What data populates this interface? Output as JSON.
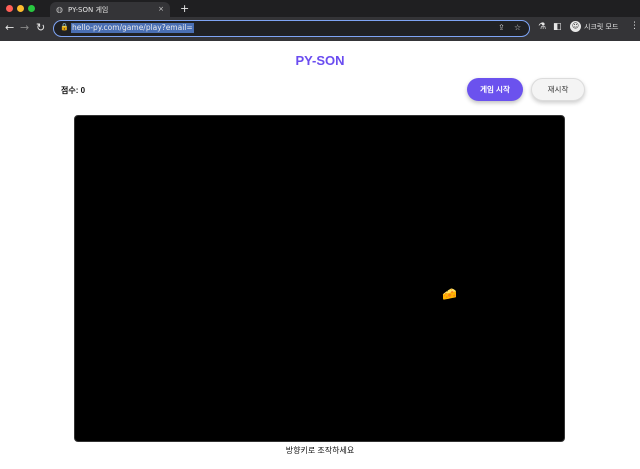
{
  "browser": {
    "tab_title": "PY-SON 게임",
    "tab_close": "×",
    "new_tab": "+",
    "url": "hello-py.com/game/play?email=",
    "profile_label": "시크릿 모드",
    "icons": [
      "back-icon",
      "forward-icon",
      "reload-icon",
      "lock-icon",
      "share-icon",
      "star-icon",
      "extension-icon",
      "sidepanel-icon",
      "profile-icon",
      "menu-icon"
    ]
  },
  "page": {
    "title": "PY-SON",
    "score_label": "점수: 0",
    "start_button": "게임 시작",
    "restart_button": "재시작",
    "hint": "방향키로 조작하세요"
  },
  "game": {
    "player_emoji": "🐮",
    "target_emoji": "🧀",
    "background": "#000000"
  },
  "colors": {
    "accent": "#6b52ee",
    "title": "#6a4cf0"
  }
}
